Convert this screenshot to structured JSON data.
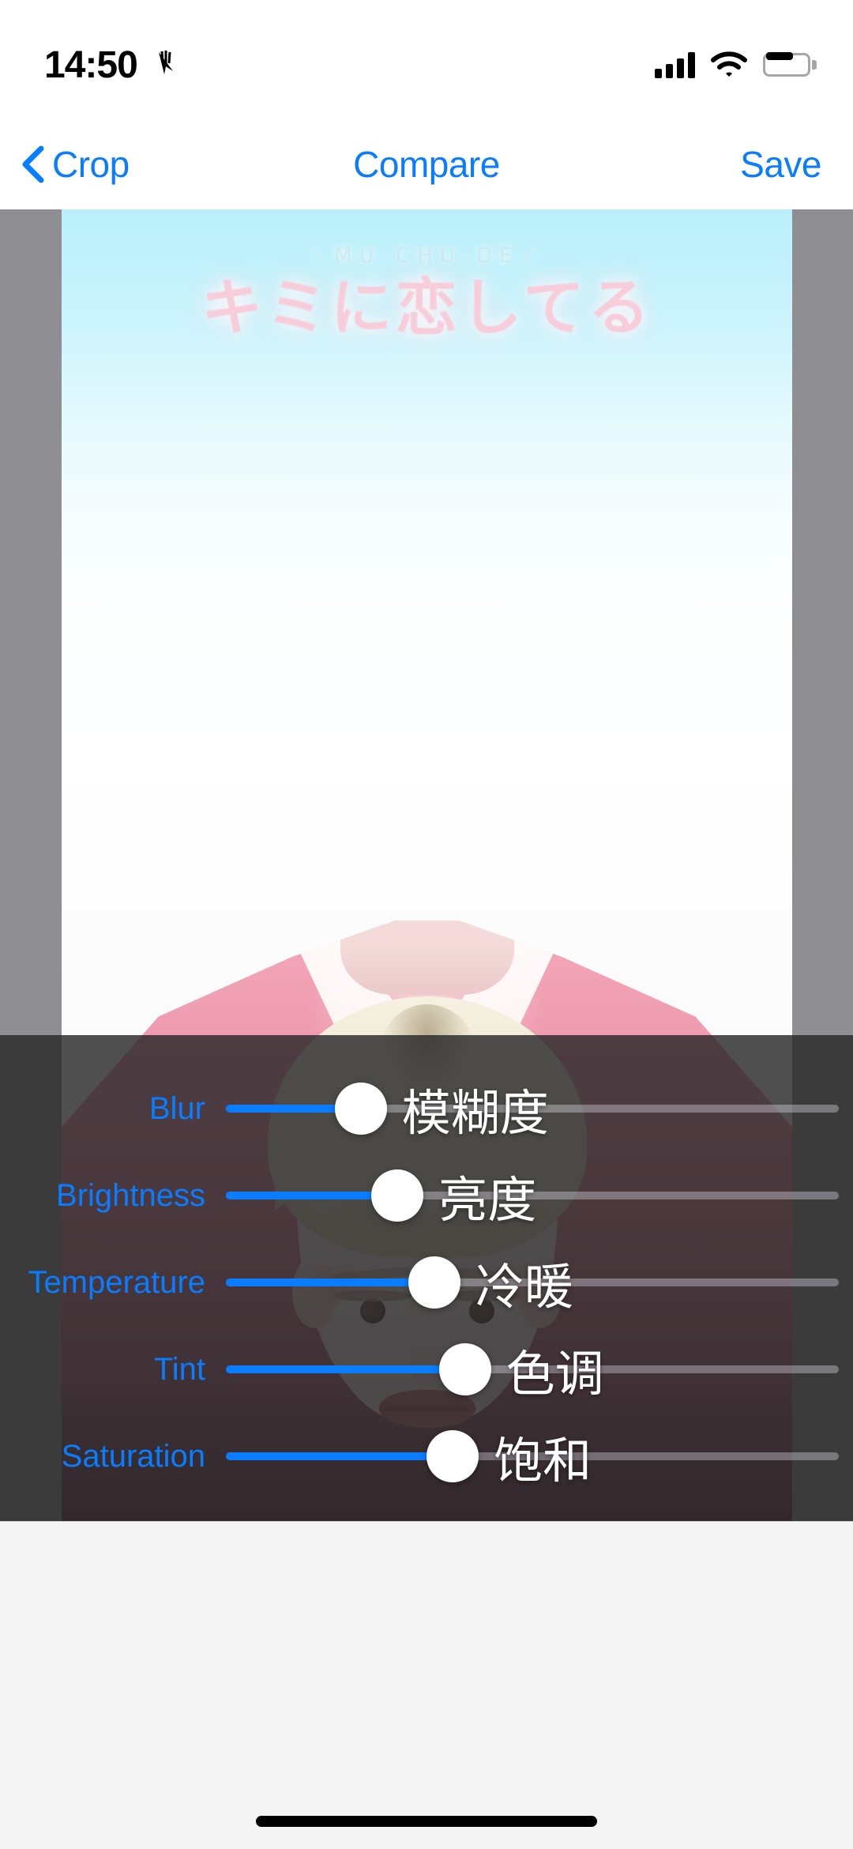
{
  "status_bar": {
    "time": "14:50",
    "location_icon": "location-arrow-icon",
    "signal_icon": "cellular-signal-icon",
    "wifi_icon": "wifi-icon",
    "battery_icon": "battery-icon",
    "signal_bars_filled": 4,
    "signal_bars_total": 4
  },
  "nav_bar": {
    "back_icon": "chevron-left-icon",
    "back_label": "Crop",
    "title": "Compare",
    "save_label": "Save",
    "accent_color": "#0a7cff"
  },
  "photo": {
    "poster_subtitle": "＼MU-CHU-DE／",
    "poster_title": "キミに恋してる",
    "subject_description": "portrait of a person with blonde hair wearing a pink hanbok"
  },
  "adjust_panel": {
    "accent_color": "#0a7cff",
    "thumb_color": "#ffffff",
    "track_color": "#ebebf5",
    "sliders": [
      {
        "label": "Blur",
        "annotation": "模糊度",
        "value": 22
      },
      {
        "label": "Brightness",
        "annotation": "亮度",
        "value": 28
      },
      {
        "label": "Temperature",
        "annotation": "冷暖",
        "value": 34
      },
      {
        "label": "Tint",
        "annotation": "色调",
        "value": 39
      },
      {
        "label": "Saturation",
        "annotation": "饱和",
        "value": 37
      }
    ]
  },
  "bottom": {
    "home_indicator": "home-indicator"
  }
}
